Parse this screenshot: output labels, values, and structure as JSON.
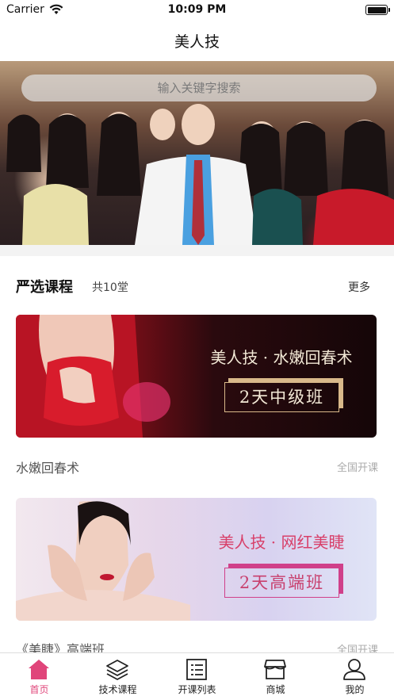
{
  "status_bar": {
    "carrier": "Carrier",
    "time": "10:09 PM"
  },
  "nav": {
    "title": "美人技"
  },
  "search": {
    "placeholder": "输入关键字搜索"
  },
  "section": {
    "title": "严选课程",
    "count": "共10堂",
    "more": "更多"
  },
  "courses": [
    {
      "headline": "美人技 · 水嫩回春术",
      "badge": "2天中级班",
      "name": "水嫩回春术",
      "tag": "全国开课"
    },
    {
      "headline": "美人技 · 网红美睫",
      "badge": "2天高端班",
      "name": "《美睫》高端班",
      "tag": "全国开课"
    }
  ],
  "tabs": [
    {
      "label": "首页",
      "icon": "home-icon",
      "active": true
    },
    {
      "label": "技术课程",
      "icon": "layers-icon",
      "active": false
    },
    {
      "label": "开课列表",
      "icon": "list-icon",
      "active": false
    },
    {
      "label": "商城",
      "icon": "shop-icon",
      "active": false
    },
    {
      "label": "我的",
      "icon": "user-icon",
      "active": false
    }
  ],
  "colors": {
    "accent": "#e0457a",
    "tab_inactive": "#222222",
    "divider": "#f3f3f3"
  }
}
